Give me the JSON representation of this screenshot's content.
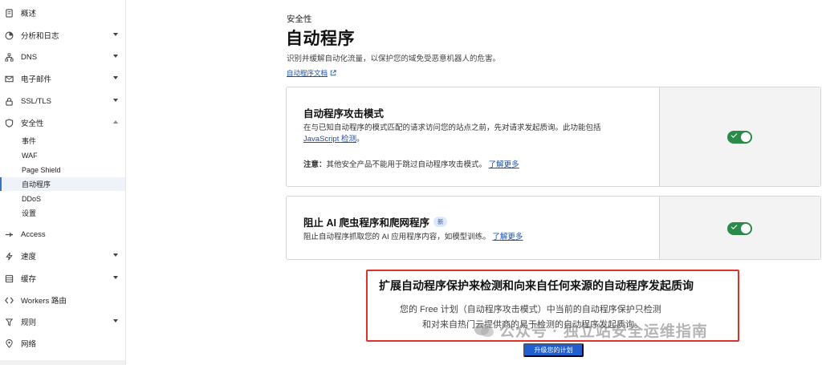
{
  "sidebar": {
    "items": [
      {
        "label": "概述",
        "icon": "document-icon"
      },
      {
        "label": "分析和日志",
        "icon": "clock-chart-icon"
      },
      {
        "label": "DNS",
        "icon": "network-icon"
      },
      {
        "label": "电子邮件",
        "icon": "mail-icon"
      },
      {
        "label": "SSL/TLS",
        "icon": "lock-icon"
      },
      {
        "label": "安全性",
        "icon": "shield-icon"
      },
      {
        "label": "Access",
        "icon": "access-icon"
      },
      {
        "label": "速度",
        "icon": "bolt-icon"
      },
      {
        "label": "缓存",
        "icon": "cache-icon"
      },
      {
        "label": "Workers 路由",
        "icon": "workers-icon"
      },
      {
        "label": "规则",
        "icon": "rules-icon"
      },
      {
        "label": "网络",
        "icon": "location-icon"
      }
    ],
    "security_sub": [
      "事件",
      "WAF",
      "Page Shield",
      "自动程序",
      "DDoS",
      "设置"
    ]
  },
  "main": {
    "section": "安全性",
    "title": "自动程序",
    "description": "识别并缓解自动化流量，以保护您的域免受恶意机器人的危害。",
    "doc_link": "自动程序文档"
  },
  "card1": {
    "title": "自动程序攻击模式",
    "text_line1": "在与已知自动程序的模式匹配的请求访问您的站点之前，先对请求发起质询。此功能包括",
    "link1": "JavaScript 检测",
    "period": "。",
    "note_label": "注意：",
    "note_text": "其他安全产品不能用于跳过自动程序攻击模式。",
    "learn_more": "了解更多",
    "toggle_on": true
  },
  "card2": {
    "title": "阻止 AI 爬虫程序和爬网程序",
    "badge": "新",
    "text": "阻止自动程序抓取您的 AI 应用程序内容，如模型训练。",
    "learn_more": "了解更多",
    "toggle_on": true
  },
  "upsell": {
    "title": "扩展自动程序保护来检测和向来自任何来源的自动程序发起质询",
    "line1": "您的 Free 计划（自动程序攻击模式）中当前的自动程序保护只检测",
    "line2": "和对来自热门云提供商的易于检测的自动程序发起质询。",
    "button": "升级您的计划"
  },
  "watermark": "公众号 · 独立站安全运维指南",
  "colors": {
    "accent": "#1f5fcf",
    "toggle": "#2a8a4a",
    "highlight_border": "#e0312b",
    "active_nav": "#eef3fa"
  }
}
